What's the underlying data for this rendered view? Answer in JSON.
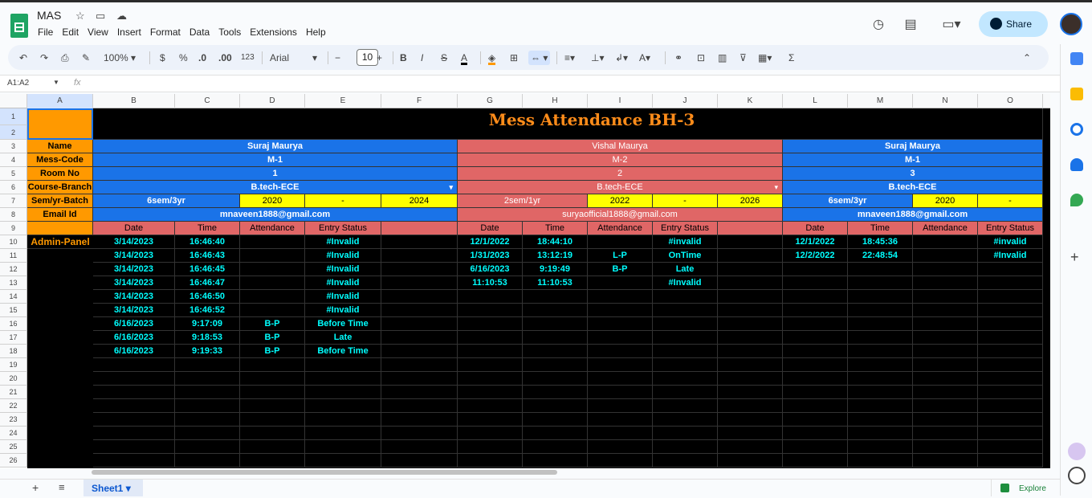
{
  "app": {
    "title": "MAS",
    "menu": [
      "File",
      "Edit",
      "View",
      "Insert",
      "Format",
      "Data",
      "Tools",
      "Extensions",
      "Help"
    ],
    "share_label": "Share"
  },
  "toolbar": {
    "zoom": "100%",
    "currency": "$",
    "percent": "%",
    "dec_less": ".0",
    "dec_more": ".00",
    "number_format": "123",
    "font": "Arial",
    "font_size": "10"
  },
  "formula_bar": {
    "name_box": "A1:A2",
    "fx": "fx"
  },
  "sheet": {
    "tab": "Sheet1",
    "explore": "Explore",
    "columns": [
      "A",
      "B",
      "C",
      "D",
      "E",
      "F",
      "G",
      "H",
      "I",
      "J",
      "K",
      "L",
      "M",
      "N",
      "O"
    ],
    "rows": [
      "1",
      "2",
      "3",
      "4",
      "5",
      "6",
      "7",
      "8",
      "9",
      "10",
      "11",
      "12",
      "13",
      "14",
      "15",
      "16",
      "17",
      "18",
      "19",
      "20",
      "21",
      "22",
      "23",
      "24",
      "25",
      "26"
    ],
    "title": "Mess Attendance BH-3",
    "labels": [
      "Name",
      "Mess-Code",
      "Room No",
      "Course-Branch",
      "Sem/yr-Batch",
      "Email Id"
    ],
    "admin_label": "Admin-Panel",
    "students": [
      {
        "name": "Suraj Maurya",
        "mess": "M-1",
        "room": "1",
        "course": "B.tech-ECE",
        "sem": "6sem/3yr",
        "batch_start": "2020",
        "dash": "-",
        "batch_end": "2024",
        "email": "mnaveen1888@gmail.com"
      },
      {
        "name": "Vishal Maurya",
        "mess": "M-2",
        "room": "2",
        "course": "B.tech-ECE",
        "sem": "2sem/1yr",
        "batch_start": "2022",
        "dash": "-",
        "batch_end": "2026",
        "email": "suryaofficial1888@gmail.com"
      },
      {
        "name": "Suraj Maurya",
        "mess": "M-1",
        "room": "3",
        "course": "B.tech-ECE",
        "sem": "6sem/3yr",
        "batch_start": "2020",
        "dash": "-",
        "batch_end": "",
        "email": "mnaveen1888@gmail.com"
      }
    ],
    "table_headers": [
      "Date",
      "Time",
      "Attendance",
      "Entry Status"
    ],
    "records1": [
      [
        "3/14/2023",
        "16:46:40",
        "",
        "#Invalid"
      ],
      [
        "3/14/2023",
        "16:46:43",
        "",
        "#Invalid"
      ],
      [
        "3/14/2023",
        "16:46:45",
        "",
        "#Invalid"
      ],
      [
        "3/14/2023",
        "16:46:47",
        "",
        "#Invalid"
      ],
      [
        "3/14/2023",
        "16:46:50",
        "",
        "#Invalid"
      ],
      [
        "3/14/2023",
        "16:46:52",
        "",
        "#Invalid"
      ],
      [
        "6/16/2023",
        "9:17:09",
        "B-P",
        "Before Time"
      ],
      [
        "6/16/2023",
        "9:18:53",
        "B-P",
        "Late"
      ],
      [
        "6/16/2023",
        "9:19:33",
        "B-P",
        "Before Time"
      ]
    ],
    "records2": [
      [
        "12/1/2022",
        "18:44:10",
        "",
        "#invalid"
      ],
      [
        "1/31/2023",
        "13:12:19",
        "L-P",
        "OnTime"
      ],
      [
        "6/16/2023",
        "9:19:49",
        "B-P",
        "Late"
      ],
      [
        "11:10:53",
        "11:10:53",
        "",
        "#Invalid"
      ]
    ],
    "records3": [
      [
        "12/1/2022",
        "18:45:36",
        "",
        "#invalid"
      ],
      [
        "12/2/2022",
        "22:48:54",
        "",
        "#Invalid"
      ]
    ]
  },
  "colors": {
    "label_orange": "#ff9900",
    "blue": "#1a73e8",
    "red": "#e06666",
    "yellow": "#ffff00",
    "cyan_text": "#00ffff",
    "title_orange": "#ff8c1a"
  }
}
